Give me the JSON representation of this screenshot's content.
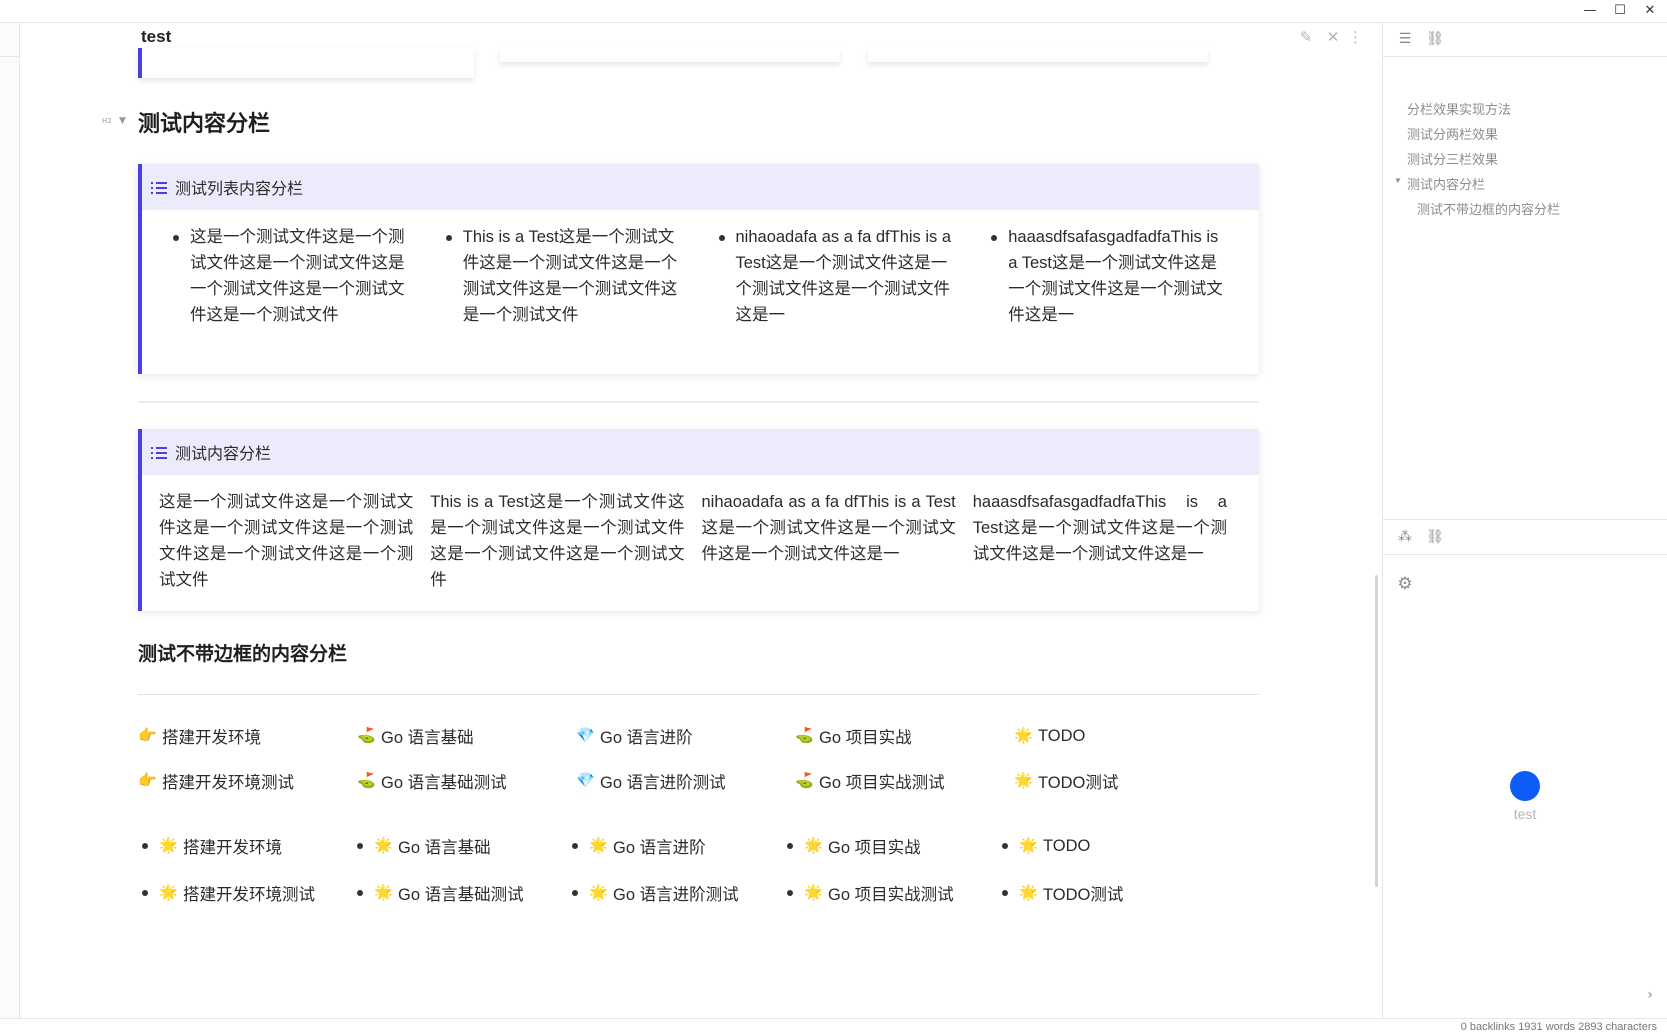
{
  "window": {
    "minimize": "—",
    "maximize": "☐",
    "close": "✕"
  },
  "note": {
    "title": "test"
  },
  "section1": {
    "heading": "测试内容分栏",
    "h2_marker": "H2",
    "callout_list": {
      "title": "测试列表内容分栏",
      "items": [
        "这是一个测试文件这是一个测试文件这是一个测试文件这是一个测试文件这是一个测试文件这是一个测试文件",
        "This is a Test这是一个测试文件这是一个测试文件这是一个测试文件这是一个测试文件这是一个测试文件",
        "nihaoadafa as a fa dfThis is a Test这是一个测试文件这是一个测试文件这是一个测试文件这是一",
        "haaasdfsafasgadfadfaThis is a Test这是一个测试文件这是一个测试文件这是一个测试文件这是一"
      ]
    },
    "callout_content": {
      "title": "测试内容分栏",
      "columns": [
        "这是一个测试文件这是一个测试文件这是一个测试文件这是一个测试文件这是一个测试文件这是一个测试文件",
        "This is a Test这是一个测试文件这是一个测试文件这是一个测试文件这是一个测试文件这是一个测试文件",
        "nihaoadafa as a fa dfThis is a Test这是一个测试文件这是一个测试文件这是一个测试文件这是一",
        "haaasdfsafasgadfadfaThis is a Test这是一个测试文件这是一个测试文件这是一个测试文件这是一"
      ]
    }
  },
  "section2": {
    "heading": "测试不带边框的内容分栏",
    "grid_row1": [
      {
        "emoji": "👉",
        "text": "搭建开发环境"
      },
      {
        "emoji": "⛳",
        "text": "Go 语言基础"
      },
      {
        "emoji": "💎",
        "text": "Go 语言进阶"
      },
      {
        "emoji": "⛳",
        "text": "Go 项目实战"
      },
      {
        "emoji": "🌟",
        "text": "TODO"
      }
    ],
    "grid_row2": [
      {
        "emoji": "👉",
        "text": "搭建开发环境测试"
      },
      {
        "emoji": "⛳",
        "text": "Go 语言基础测试"
      },
      {
        "emoji": "💎",
        "text": "Go 语言进阶测试"
      },
      {
        "emoji": "⛳",
        "text": "Go 项目实战测试"
      },
      {
        "emoji": "🌟",
        "text": "TODO测试"
      }
    ],
    "bullet_row1": [
      {
        "emoji": "🌟",
        "text": "搭建开发环境"
      },
      {
        "emoji": "🌟",
        "text": "Go 语言基础"
      },
      {
        "emoji": "🌟",
        "text": "Go 语言进阶"
      },
      {
        "emoji": "🌟",
        "text": "Go 项目实战"
      },
      {
        "emoji": "🌟",
        "text": "TODO"
      }
    ],
    "bullet_row2": [
      {
        "emoji": "🌟",
        "text": "搭建开发环境测试"
      },
      {
        "emoji": "🌟",
        "text": "Go 语言基础测试"
      },
      {
        "emoji": "🌟",
        "text": "Go 语言进阶测试"
      },
      {
        "emoji": "🌟",
        "text": "Go 项目实战测试"
      },
      {
        "emoji": "🌟",
        "text": "TODO测试"
      }
    ]
  },
  "outline": {
    "items": [
      "分栏效果实现方法",
      "测试分两栏效果",
      "测试分三栏效果",
      "测试内容分栏",
      "测试不带边框的内容分栏"
    ]
  },
  "graph": {
    "node_label": "test"
  },
  "status": {
    "text": "0 backlinks   1931 words   2893 characters"
  },
  "colors": {
    "callout_accent": "#4b3fe0",
    "callout_header_bg": "#ebebfb",
    "graph_node": "#0e5cf7"
  }
}
